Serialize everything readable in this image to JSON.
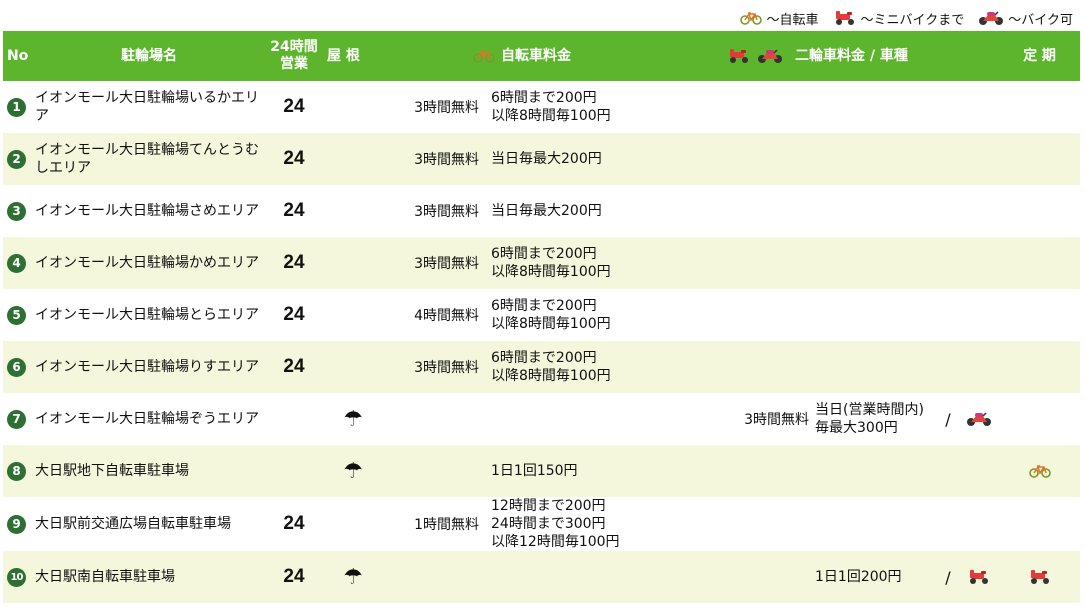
{
  "legend": [
    {
      "icon": "bicycle-icon",
      "label": "～自転車"
    },
    {
      "icon": "minibike-icon",
      "label": "～ミニバイクまで"
    },
    {
      "icon": "motorbike-icon",
      "label": "～バイク可"
    }
  ],
  "header": {
    "no": "No",
    "name": "駐輪場名",
    "hours_line1": "24時間",
    "hours_line2": "営業",
    "roof": "屋 根",
    "bicycle_fee": "自転車料金",
    "motorcycle_fee": "二輪車料金 / 車種",
    "pass": "定 期"
  },
  "colors": {
    "header_bg": "#5cb52d",
    "row_alt_bg": "#f4f7dc",
    "number_badge": "#2e6f34"
  },
  "rows": [
    {
      "no": "1",
      "name": "イオンモール大日駐輪場いるかエリア",
      "h24": "24",
      "roof": false,
      "bike_free": "3時間無料",
      "bike_fee": [
        "6時間まで200円",
        "以降8時間毎100円"
      ],
      "moto_free": "",
      "moto_fee": [],
      "moto_slash": "",
      "moto_type": "",
      "pass": ""
    },
    {
      "no": "2",
      "name": "イオンモール大日駐輪場てんとうむしエリア",
      "h24": "24",
      "roof": false,
      "bike_free": "3時間無料",
      "bike_fee": [
        "当日毎最大200円"
      ],
      "moto_free": "",
      "moto_fee": [],
      "moto_slash": "",
      "moto_type": "",
      "pass": ""
    },
    {
      "no": "3",
      "name": "イオンモール大日駐輪場さめエリア",
      "h24": "24",
      "roof": false,
      "bike_free": "3時間無料",
      "bike_fee": [
        "当日毎最大200円"
      ],
      "moto_free": "",
      "moto_fee": [],
      "moto_slash": "",
      "moto_type": "",
      "pass": ""
    },
    {
      "no": "4",
      "name": "イオンモール大日駐輪場かめエリア",
      "h24": "24",
      "roof": false,
      "bike_free": "3時間無料",
      "bike_fee": [
        "6時間まで200円",
        "以降8時間毎100円"
      ],
      "moto_free": "",
      "moto_fee": [],
      "moto_slash": "",
      "moto_type": "",
      "pass": ""
    },
    {
      "no": "5",
      "name": "イオンモール大日駐輪場とらエリア",
      "h24": "24",
      "roof": false,
      "bike_free": "4時間無料",
      "bike_fee": [
        "6時間まで200円",
        "以降8時間毎100円"
      ],
      "moto_free": "",
      "moto_fee": [],
      "moto_slash": "",
      "moto_type": "",
      "pass": ""
    },
    {
      "no": "6",
      "name": "イオンモール大日駐輪場りすエリア",
      "h24": "24",
      "roof": false,
      "bike_free": "3時間無料",
      "bike_fee": [
        "6時間まで200円",
        "以降8時間毎100円"
      ],
      "moto_free": "",
      "moto_fee": [],
      "moto_slash": "",
      "moto_type": "",
      "pass": ""
    },
    {
      "no": "7",
      "name": "イオンモール大日駐輪場ぞうエリア",
      "h24": "",
      "roof": true,
      "bike_free": "",
      "bike_fee": [],
      "moto_free": "3時間無料",
      "moto_fee": [
        "当日(営業時間内)",
        "毎最大300円"
      ],
      "moto_slash": "/",
      "moto_type": "motorbike-icon",
      "pass": ""
    },
    {
      "no": "8",
      "name": "大日駅地下自転車駐車場",
      "h24": "",
      "roof": true,
      "bike_free": "",
      "bike_fee": [
        "1日1回150円"
      ],
      "moto_free": "",
      "moto_fee": [],
      "moto_slash": "",
      "moto_type": "",
      "pass": "bicycle-icon"
    },
    {
      "no": "9",
      "name": "大日駅前交通広場自転車駐車場",
      "h24": "24",
      "roof": false,
      "bike_free": "1時間無料",
      "bike_fee": [
        "12時間まで200円",
        "24時間まで300円",
        "以降12時間毎100円"
      ],
      "moto_free": "",
      "moto_fee": [],
      "moto_slash": "",
      "moto_type": "",
      "pass": ""
    },
    {
      "no": "10",
      "name": "大日駅南自転車駐車場",
      "h24": "24",
      "roof": true,
      "bike_free": "",
      "bike_fee": [],
      "moto_free": "",
      "moto_fee": [
        "1日1回200円"
      ],
      "moto_slash": "/",
      "moto_type": "minibike-icon",
      "pass": "minibike-icon"
    }
  ]
}
